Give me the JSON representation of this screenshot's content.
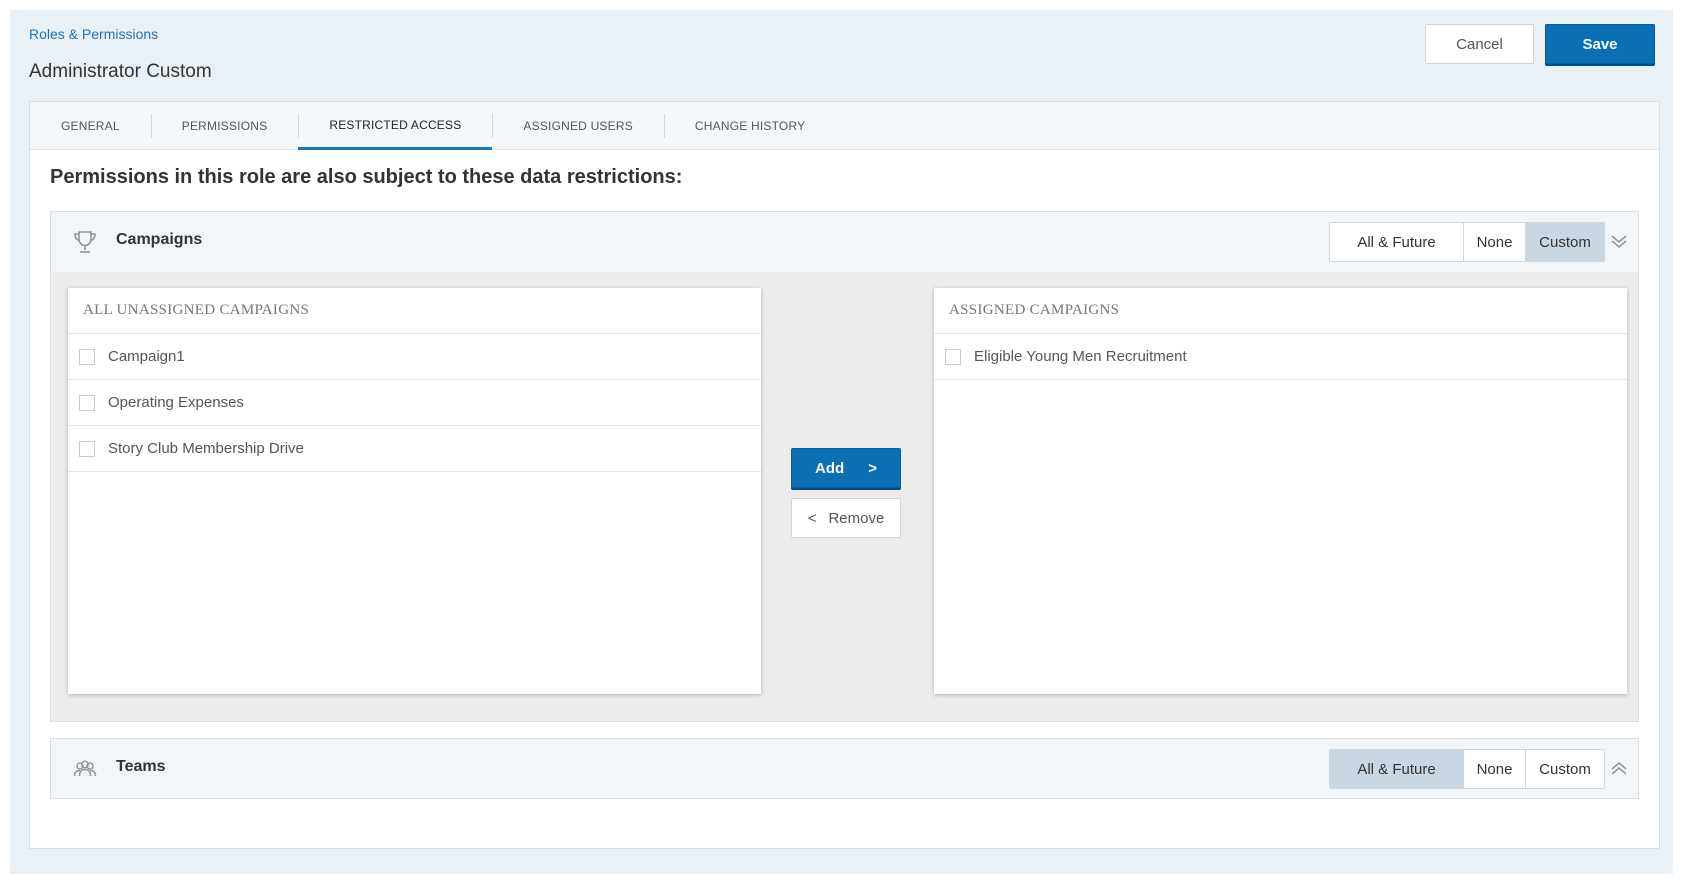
{
  "breadcrumb": "Roles & Permissions",
  "page_title": "Administrator Custom",
  "actions": {
    "cancel": "Cancel",
    "save": "Save"
  },
  "tabs": [
    {
      "label": "GENERAL",
      "active": false
    },
    {
      "label": "PERMISSIONS",
      "active": false
    },
    {
      "label": "RESTRICTED ACCESS",
      "active": true
    },
    {
      "label": "ASSIGNED USERS",
      "active": false
    },
    {
      "label": "CHANGE HISTORY",
      "active": false
    }
  ],
  "section_heading": "Permissions in this role are also subject to these data restrictions:",
  "campaigns": {
    "title": "Campaigns",
    "icon": "trophy-icon",
    "options": [
      "All & Future",
      "None",
      "Custom"
    ],
    "selected": "Custom",
    "chevron": "chevron-double-down-icon",
    "unassigned": {
      "header": "ALL UNASSIGNED CAMPAIGNS",
      "items": [
        "Campaign1",
        "Operating Expenses",
        "Story Club Membership Drive"
      ]
    },
    "assigned": {
      "header": "ASSIGNED CAMPAIGNS",
      "items": [
        "Eligible Young Men Recruitment"
      ]
    },
    "add_label": "Add",
    "add_arrow": ">",
    "remove_label": "Remove",
    "remove_arrow": "<"
  },
  "teams": {
    "title": "Teams",
    "icon": "group-icon",
    "options": [
      "All & Future",
      "None",
      "Custom"
    ],
    "selected": "All & Future",
    "chevron": "chevron-double-up-icon"
  },
  "colors": {
    "accent": "#0a6fb4",
    "link": "#1b75bb",
    "selected_segment": "#c9d7e2",
    "page_background": "#e9f0f6"
  }
}
